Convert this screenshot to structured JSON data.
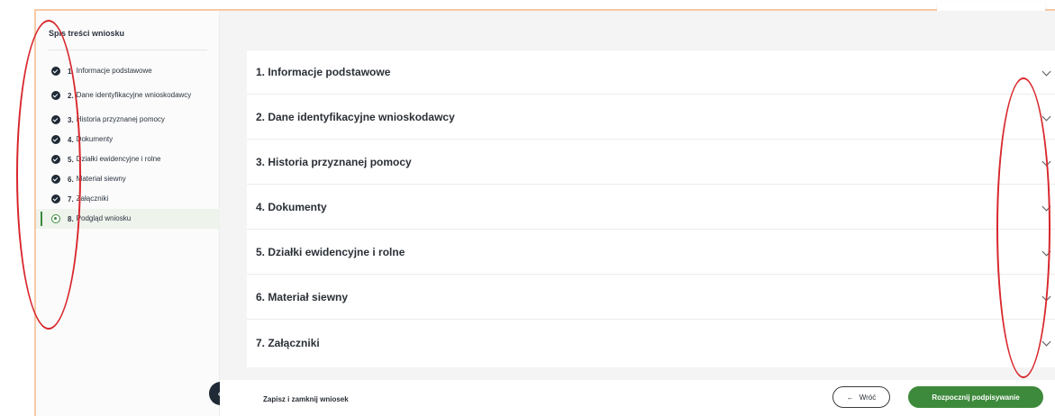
{
  "sidebar": {
    "title": "Spis treści wniosku",
    "items": [
      {
        "num": "1.",
        "label": "Informacje podstawowe",
        "state": "done"
      },
      {
        "num": "2.",
        "label": "Dane identyfikacyjne wnioskodawcy",
        "state": "done"
      },
      {
        "num": "3.",
        "label": "Historia przyznanej pomocy",
        "state": "done"
      },
      {
        "num": "4.",
        "label": "Dokumenty",
        "state": "done"
      },
      {
        "num": "5.",
        "label": "Działki ewidencyjne i rolne",
        "state": "done"
      },
      {
        "num": "6.",
        "label": "Materiał siewny",
        "state": "done"
      },
      {
        "num": "7.",
        "label": "Załączniki",
        "state": "done"
      },
      {
        "num": "8.",
        "label": "Podgląd wniosku",
        "state": "active"
      }
    ],
    "collapse_glyph": "«"
  },
  "sections": [
    {
      "title": "1. Informacje podstawowe"
    },
    {
      "title": "2. Dane identyfikacyjne wnioskodawcy"
    },
    {
      "title": "3. Historia przyznanej pomocy"
    },
    {
      "title": "4. Dokumenty"
    },
    {
      "title": "5. Działki ewidencyjne i rolne"
    },
    {
      "title": "6. Materiał siewny"
    },
    {
      "title": "7. Załączniki"
    }
  ],
  "footer": {
    "save_label": "Zapisz i zamknij wniosek",
    "back_label": "Wróć",
    "back_arrow": "←",
    "start_label": "Rozpocznij podpisywanie"
  },
  "colors": {
    "accent_green": "#3e8a3c",
    "dark_navy": "#1f2a36",
    "annotation_red": "#d8262b",
    "frame_orange": "#f6c9a6"
  },
  "icons": {
    "done": "check-circle-icon",
    "active": "radio-active-icon",
    "chevron": "chevron-down-icon",
    "collapse": "double-chevron-left-icon"
  }
}
